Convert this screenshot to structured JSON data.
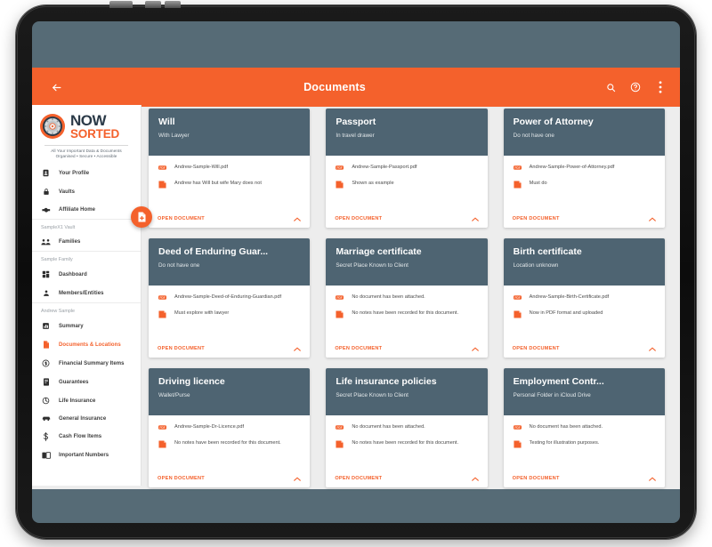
{
  "app_bar": {
    "title": "Documents",
    "back_icon": "back-arrow-icon",
    "search_icon": "search-icon",
    "help_icon": "help-circle-icon",
    "overflow_icon": "more-vertical-icon"
  },
  "colors": {
    "accent_orange": "#f4612c",
    "card_header_slate": "#4e6472",
    "screen_bg": "#566b76",
    "content_bg": "#ededed",
    "logo_navy": "#2b3a48"
  },
  "sidebar": {
    "logo": {
      "now": "NOW",
      "sorted": "SORTED",
      "tagline_line1": "All Your Important Data & Documents",
      "tagline_line2": "Organised • Secure • Accessible"
    },
    "top_items": [
      {
        "label": "Your Profile",
        "icon": "profile-badge-icon"
      },
      {
        "label": "Vaults",
        "icon": "lock-icon"
      },
      {
        "label": "Affiliate Home",
        "icon": "handshake-icon"
      }
    ],
    "sections": [
      {
        "label": "SampleX1 Vault",
        "items": [
          {
            "label": "Families",
            "icon": "families-icon"
          }
        ]
      },
      {
        "label": "Sample Family",
        "items": [
          {
            "label": "Dashboard",
            "icon": "dashboard-grid-icon"
          },
          {
            "label": "Members/Entities",
            "icon": "person-icon"
          }
        ]
      },
      {
        "label": "Andrew Sample",
        "items": [
          {
            "label": "Summary",
            "icon": "summary-icon",
            "active": false
          },
          {
            "label": "Documents & Locations",
            "icon": "document-icon",
            "active": true
          },
          {
            "label": "Financial Summary Items",
            "icon": "coin-icon",
            "active": false
          },
          {
            "label": "Guarantees",
            "icon": "certificate-icon",
            "active": false
          },
          {
            "label": "Life Insurance",
            "icon": "umbrella-icon",
            "active": false
          },
          {
            "label": "General Insurance",
            "icon": "car-icon",
            "active": false
          },
          {
            "label": "Cash Flow Items",
            "icon": "dollar-icon",
            "active": false
          },
          {
            "label": "Important Numbers",
            "icon": "contact-book-icon",
            "active": false
          }
        ]
      }
    ],
    "fab": {
      "icon": "add-document-icon"
    }
  },
  "cards": [
    {
      "title": "Will",
      "subtitle": "With Lawyer",
      "document": "Andrew-Sample-Will.pdf",
      "note": "Andrew has Will but wife Mary does not",
      "action": "OPEN DOCUMENT",
      "doc_icon": "pdf-icon",
      "note_icon": "note-icon",
      "caret_icon": "chevron-up-icon"
    },
    {
      "title": "Passport",
      "subtitle": "In travel drawer",
      "document": "Andrew-Sample-Passport.pdf",
      "note": "Shown as example",
      "action": "OPEN DOCUMENT",
      "doc_icon": "pdf-icon",
      "note_icon": "note-icon",
      "caret_icon": "chevron-up-icon"
    },
    {
      "title": "Power of Attorney",
      "subtitle": "Do not have one",
      "document": "Andrew-Sample-Power-of-Attorney.pdf",
      "note": "Must do",
      "action": "OPEN DOCUMENT",
      "doc_icon": "pdf-icon",
      "note_icon": "note-icon",
      "caret_icon": "chevron-up-icon"
    },
    {
      "title": "Deed of Enduring Guar...",
      "subtitle": "Do not have one",
      "document": "Andrew-Sample-Deed-of-Enduring-Guardian.pdf",
      "note": "Must explore with lawyer",
      "action": "OPEN DOCUMENT",
      "doc_icon": "pdf-icon",
      "note_icon": "note-icon",
      "caret_icon": "chevron-up-icon"
    },
    {
      "title": "Marriage certificate",
      "subtitle": "Secret Place Known to Client",
      "document": "No document has been attached.",
      "note": "No notes have been recorded for this document.",
      "action": "OPEN DOCUMENT",
      "doc_icon": "pdf-icon",
      "note_icon": "note-icon",
      "caret_icon": "chevron-up-icon"
    },
    {
      "title": "Birth certificate",
      "subtitle": "Location unknown",
      "document": "Andrew-Sample-Birth-Certificate.pdf",
      "note": "Now in PDF format and uploaded",
      "action": "OPEN DOCUMENT",
      "doc_icon": "pdf-icon",
      "note_icon": "note-icon",
      "caret_icon": "chevron-up-icon"
    },
    {
      "title": "Driving licence",
      "subtitle": "Wallet/Purse",
      "document": "Andrew-Sample-Dr-Licence.pdf",
      "note": "No notes have been recorded for this document.",
      "action": "OPEN DOCUMENT",
      "doc_icon": "pdf-icon",
      "note_icon": "note-icon",
      "caret_icon": "chevron-up-icon"
    },
    {
      "title": "Life insurance policies",
      "subtitle": "Secret Place Known to Client",
      "document": "No document has been attached.",
      "note": "No notes have been recorded for this document.",
      "action": "OPEN DOCUMENT",
      "doc_icon": "pdf-icon",
      "note_icon": "note-icon",
      "caret_icon": "chevron-up-icon"
    },
    {
      "title": "Employment Contr...",
      "subtitle": "Personal Folder in iCloud Drive",
      "document": "No document has been attached.",
      "note": "Testing for illustration purposes.",
      "action": "OPEN DOCUMENT",
      "doc_icon": "pdf-icon",
      "note_icon": "note-icon",
      "caret_icon": "chevron-up-icon"
    }
  ]
}
